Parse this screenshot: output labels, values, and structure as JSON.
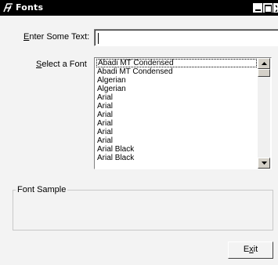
{
  "window": {
    "title": "Fonts",
    "icon": "font-app-icon",
    "controls": [
      "minimize-icon",
      "maximize-icon",
      "close-icon"
    ]
  },
  "text_input": {
    "label_accel": "E",
    "label_rest": "nter Some Text:",
    "value": ""
  },
  "font_select": {
    "label_accel": "S",
    "label_rest": "elect a Font",
    "items": [
      "Abadi MT Condensed",
      "Abadi MT Condensed",
      "Algerian",
      "Algerian",
      "Arial",
      "Arial",
      "Arial",
      "Arial",
      "Arial",
      "Arial",
      "Arial Black",
      "Arial Black"
    ],
    "scroll_position": 0.0
  },
  "sample_group": {
    "label": "Font Sample",
    "sample_text": ""
  },
  "exit_button": {
    "label_pre": "E",
    "label_accel": "x",
    "label_post": "it"
  }
}
